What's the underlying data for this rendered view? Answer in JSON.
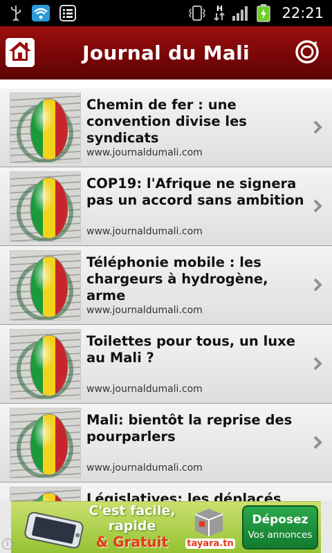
{
  "status_bar": {
    "time": "22:21",
    "network_label": "H",
    "icons": [
      "usb-icon",
      "wifi-icon",
      "notification-list-icon",
      "vibrate-icon",
      "data-arrows-icon",
      "signal-icon",
      "battery-charging-icon"
    ],
    "colors": {
      "wifi": "#2a9bd8",
      "battery": "#6ccf2a"
    }
  },
  "header": {
    "title": "Journal du Mali",
    "home_icon": "home-icon",
    "refresh_icon": "refresh-icon",
    "colors": {
      "bar_top": "#9a0f0f",
      "bar_bottom": "#5c0303"
    }
  },
  "articles": [
    {
      "title": "Chemin de fer : une convention divise les syndicats",
      "source": "www.journaldumali.com"
    },
    {
      "title": "COP19: l'Afrique ne signera pas un accord sans ambition",
      "source": "www.journaldumali.com"
    },
    {
      "title": "Téléphonie mobile : les chargeurs à hydrogène, arme",
      "source": "www.journaldumali.com"
    },
    {
      "title": "Toilettes pour tous, un luxe au Mali ?",
      "source": "www.journaldumali.com"
    },
    {
      "title": "Mali: bientôt la reprise des pourparlers",
      "source": "www.journaldumali.com"
    },
    {
      "title": "Législatives: les déplacés",
      "source": ""
    }
  ],
  "ad": {
    "line1": "C'est facile,",
    "line2": "rapide",
    "line3": "& Gratuit",
    "brand": "tayara.tn",
    "cta_title": "Déposez",
    "cta_sub": "Vos annonces",
    "info": "i",
    "colors": {
      "bg": "#a8cf45",
      "cta": "#1f9a40",
      "accent": "#e23a16"
    }
  }
}
